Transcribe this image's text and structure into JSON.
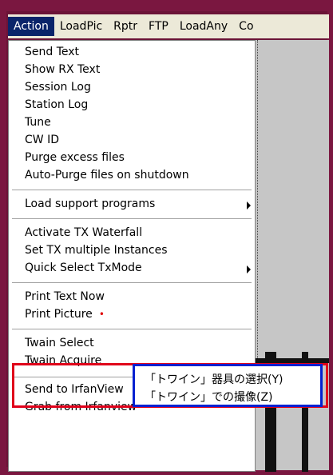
{
  "menubar": {
    "items": [
      "Action",
      "LoadPic",
      "Rptr",
      "FTP",
      "LoadAny",
      "Co"
    ]
  },
  "menu": {
    "send_text": "Send Text",
    "show_rx_text": "Show RX Text",
    "session_log": "Session Log",
    "station_log": "Station Log",
    "tune": "Tune",
    "cw_id": "CW ID",
    "purge_excess": "Purge excess files",
    "auto_purge": "Auto-Purge files on shutdown",
    "load_support": "Load support programs",
    "activate_tx": "Activate TX Waterfall",
    "set_tx_multiple": "Set TX multiple Instances",
    "quick_select": "Quick Select TxMode",
    "print_text": "Print Text Now",
    "print_picture": "Print Picture",
    "print_picture_marker": "•",
    "twain_select": "Twain Select",
    "twain_acquire": "Twain Acquire",
    "send_irfan": "Send to IrfanView",
    "grab_irfan": "Grab from Irfanview"
  },
  "annotation": {
    "twain_select_jp": "「トワイン」器具の選択(Y)",
    "twain_acquire_jp": "「トワイン」での撮像(Z)"
  },
  "colors": {
    "highlight": "#0a246a",
    "red_box": "#e0001a",
    "blue_box": "#0020d0"
  }
}
